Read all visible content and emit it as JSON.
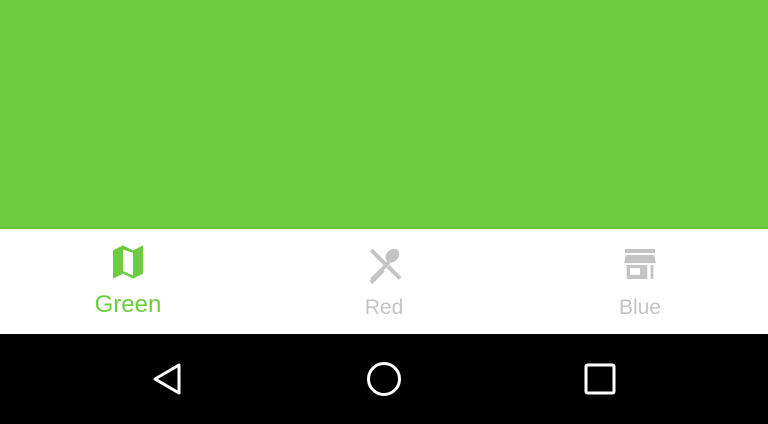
{
  "colors": {
    "accent": "#6ccb40",
    "inactive": "#c4c4c4",
    "nav_background": "#ffffff",
    "system_bar": "#000000"
  },
  "bottom_nav": {
    "items": [
      {
        "label": "Green",
        "icon": "map-icon",
        "active": true
      },
      {
        "label": "Red",
        "icon": "restaurant-icon",
        "active": false
      },
      {
        "label": "Blue",
        "icon": "store-icon",
        "active": false
      }
    ]
  },
  "system_nav": {
    "buttons": [
      "back-icon",
      "home-icon",
      "recents-icon"
    ]
  }
}
